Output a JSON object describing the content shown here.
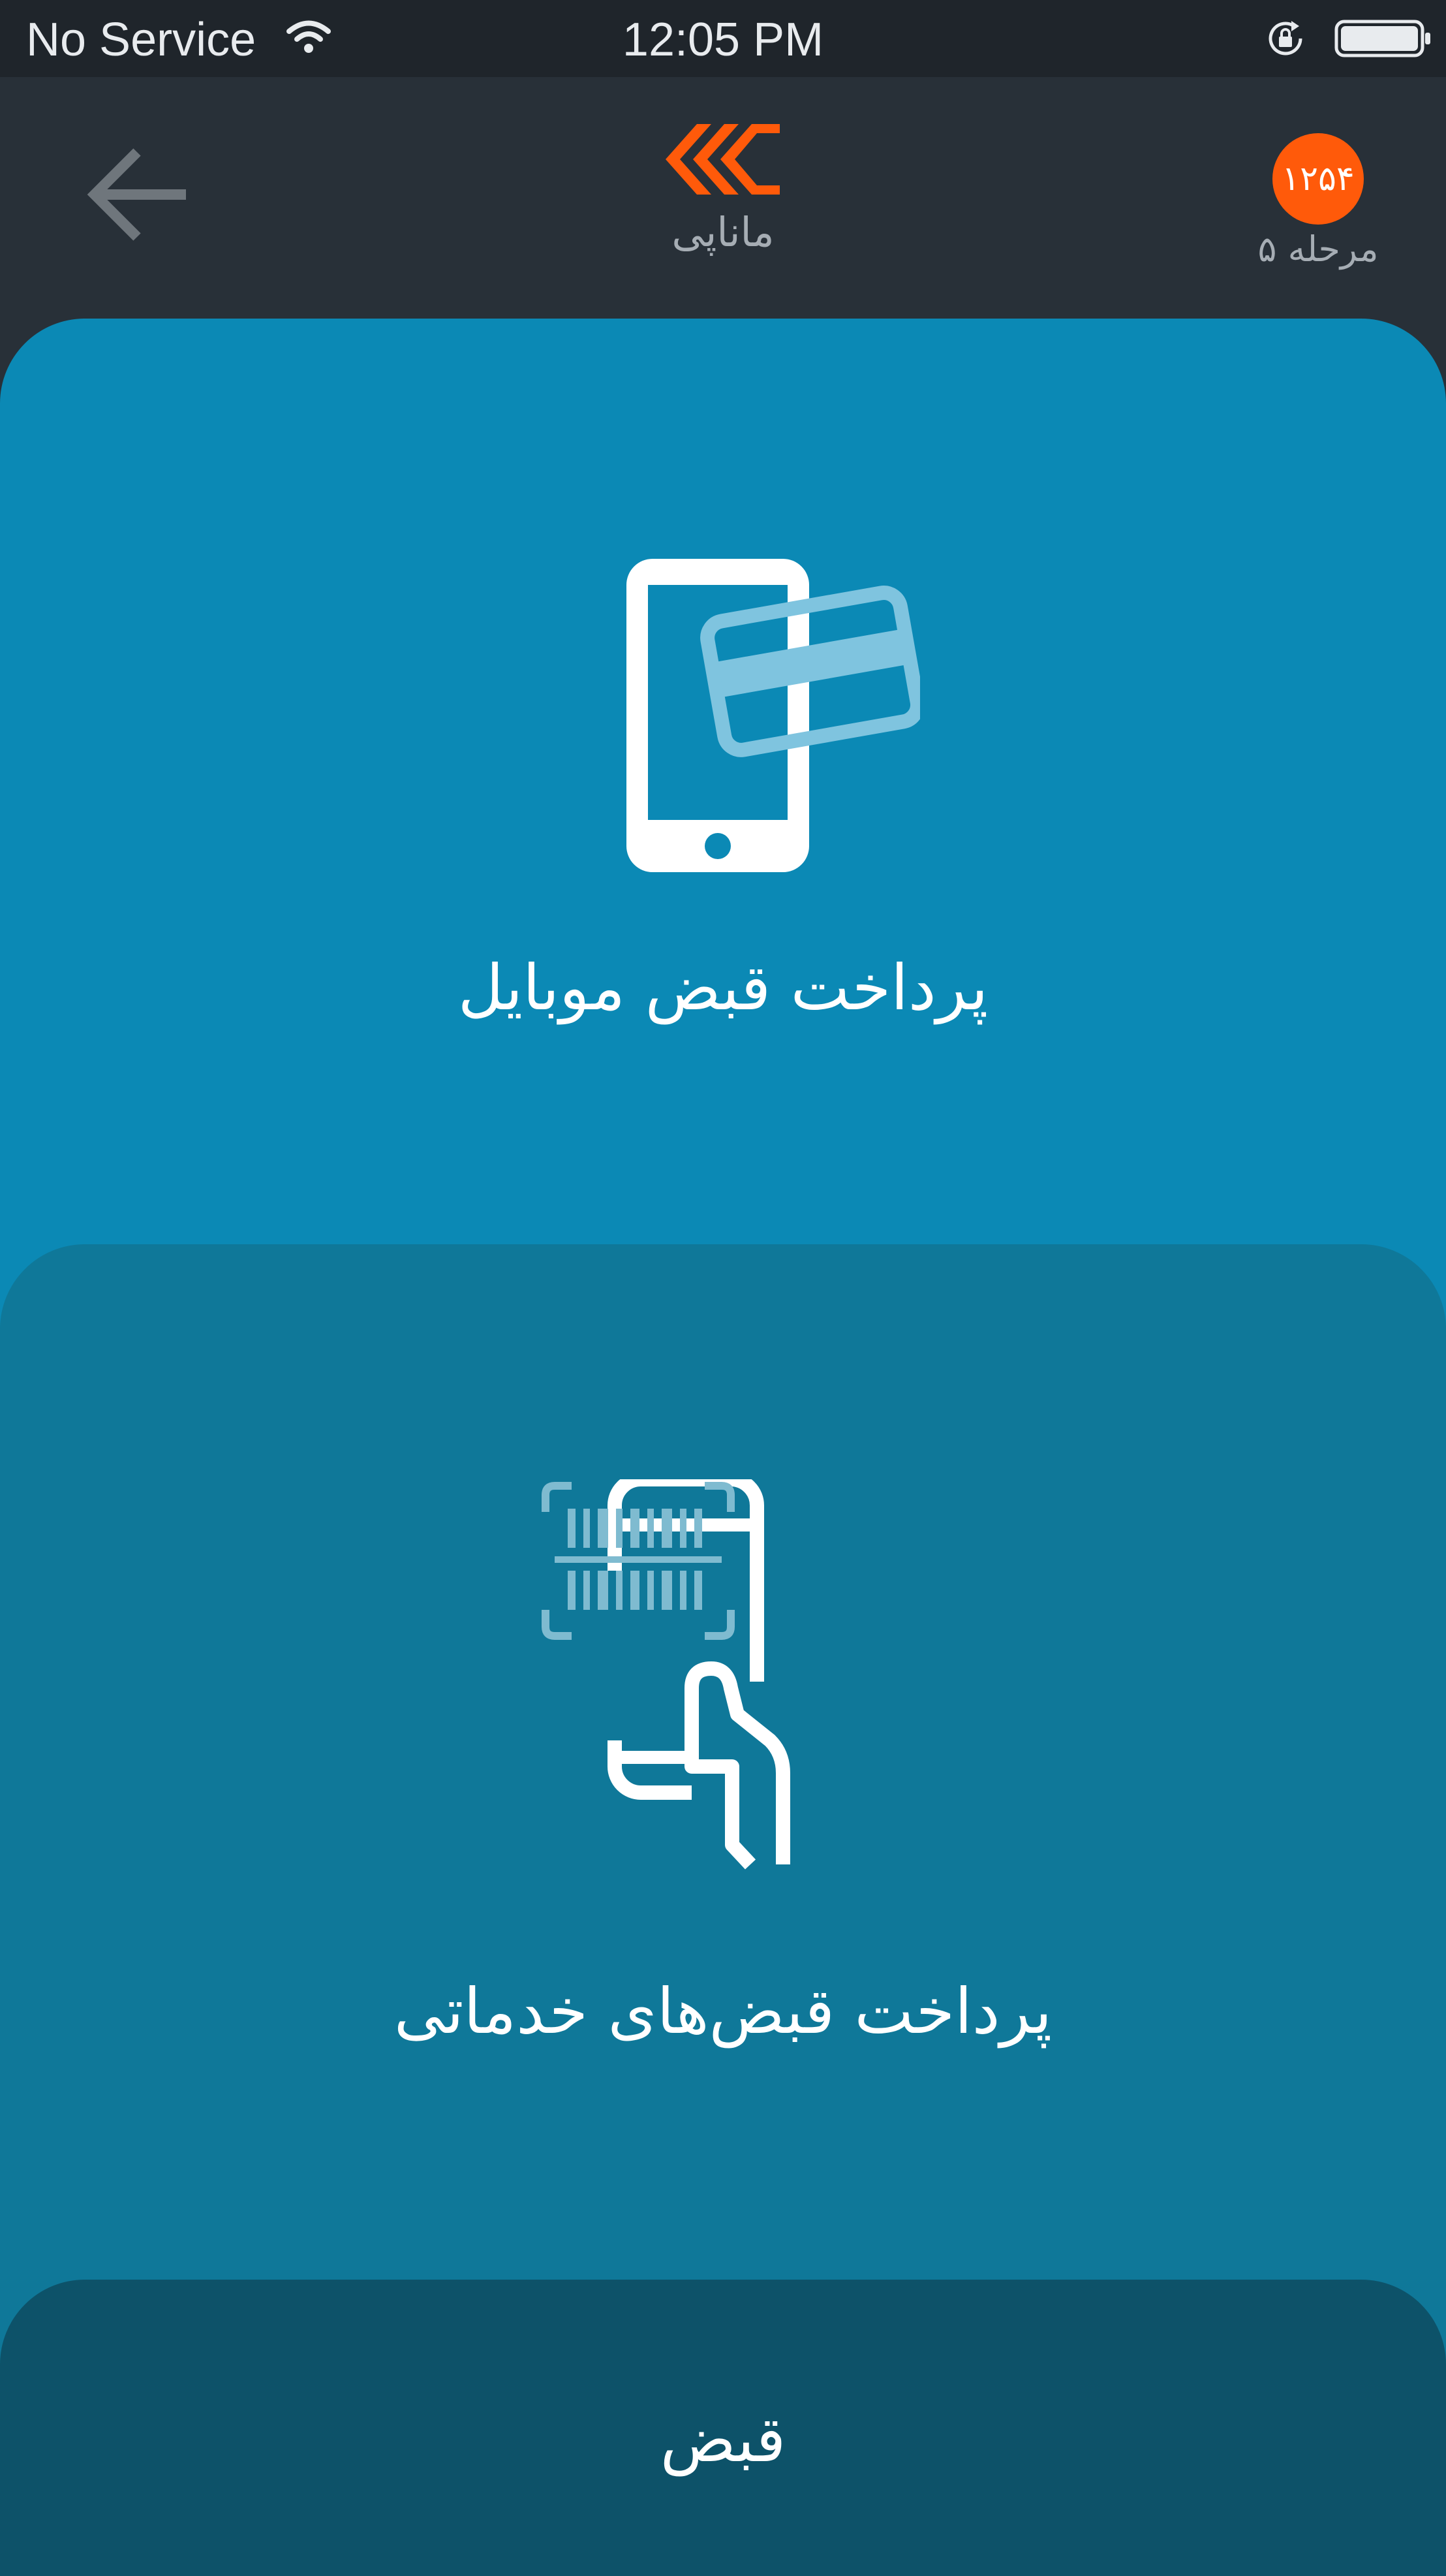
{
  "status_bar": {
    "carrier": "No Service",
    "time": "12:05 PM"
  },
  "header": {
    "app_name": "ماناپی",
    "level_count": "۱۲۵۴",
    "level_label": "مرحله ۵",
    "colors": {
      "background": "#283038",
      "badge": "#ff5a0a",
      "logo": "#ff5a0a"
    }
  },
  "cards": [
    {
      "title": "پرداخت قبض موبایل",
      "icon": "mobile-card-payment-icon",
      "color": "#0b89b5"
    },
    {
      "title": "پرداخت قبض‌های خدماتی",
      "icon": "barcode-scan-phone-icon",
      "color": "#0f7899"
    },
    {
      "title": "قبض",
      "color": "#0d5269"
    }
  ]
}
